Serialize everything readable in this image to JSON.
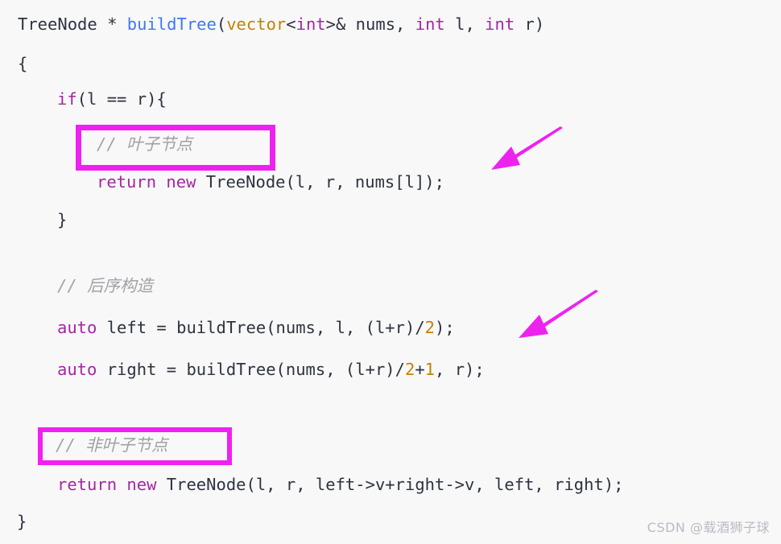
{
  "editor": {
    "background_color": "#f8f8f8",
    "default_text_color": "#2d3340",
    "keyword_color": "#a626a4",
    "function_color": "#4078f2",
    "type_color": "#c18401",
    "number_color": "#c18401",
    "comment_color": "#a0a1a7",
    "highlight_color": "#f020f0",
    "arrow_color": "#ee22ee"
  },
  "code": {
    "line1": {
      "seg1": "TreeNode * ",
      "seg2": "buildTree",
      "seg3": "(",
      "seg4": "vector",
      "seg5": "<",
      "seg6": "int",
      "seg7": ">& nums, ",
      "seg8": "int",
      "seg9": " l, ",
      "seg10": "int",
      "seg11": " r)"
    },
    "line2": "{",
    "line3": {
      "seg1": "if",
      "seg2": "(l == r){"
    },
    "line4_comment": "// 叶子节点",
    "line5": {
      "seg1": "return new",
      "seg2": " TreeNode(l, r, nums[l]);"
    },
    "line6": "}",
    "line7_comment": "// 后序构造",
    "line8": {
      "seg1": "auto",
      "seg2": " left = buildTree(nums, l, (l+r)/",
      "seg3": "2",
      "seg4": ");"
    },
    "line9": {
      "seg1": "auto",
      "seg2": " right = buildTree(nums, (l+r)/",
      "seg3": "2",
      "seg4": "+",
      "seg5": "1",
      "seg6": ", r);"
    },
    "line10_comment": "// 非叶子节点",
    "line11": {
      "seg1": "return new",
      "seg2": " TreeNode(l, r, left->v+right->v, left, right);"
    },
    "line12": "}"
  },
  "annotations": {
    "highlight_box_1_label": "leaf-node-comment-highlight",
    "highlight_box_2_label": "non-leaf-node-comment-highlight",
    "arrow_1_label": "arrow-pointing-to-leaf-node-comment",
    "arrow_2_label": "arrow-pointing-to-postorder-build"
  },
  "watermark": {
    "text": "CSDN @载酒狮子球"
  }
}
